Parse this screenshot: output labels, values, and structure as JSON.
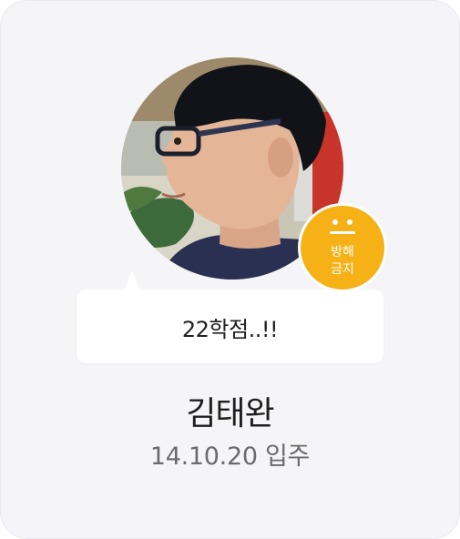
{
  "profile": {
    "status_message": "22학점..!!",
    "name": "김태완",
    "move_in": "14.10.20 입주",
    "badge": {
      "icon": "neutral-face-icon",
      "line1": "방해",
      "line2": "금지",
      "color": "#f6b117"
    },
    "avatar_icon": "profile-photo"
  }
}
